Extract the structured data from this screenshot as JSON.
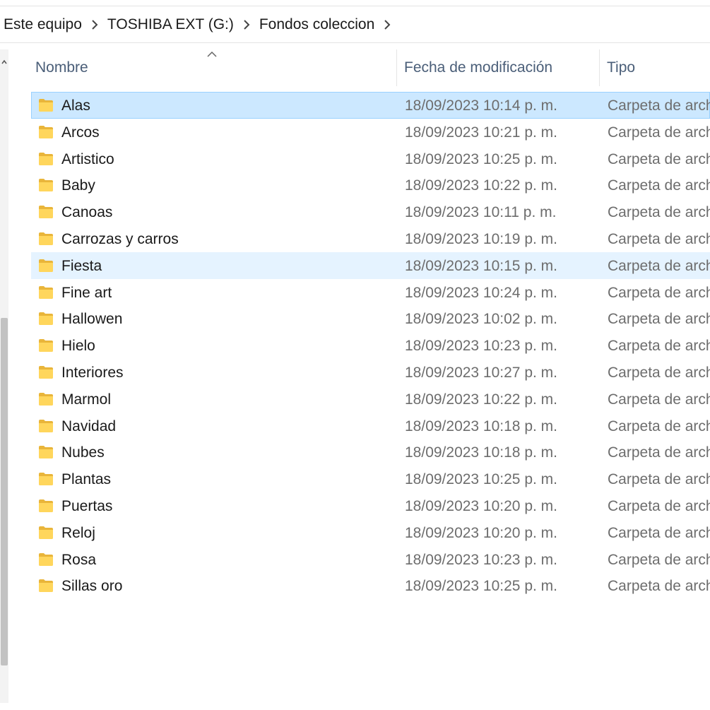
{
  "breadcrumb": {
    "items": [
      {
        "label": "Este equipo"
      },
      {
        "label": "TOSHIBA EXT (G:)"
      },
      {
        "label": "Fondos coleccion"
      }
    ]
  },
  "columns": {
    "name": "Nombre",
    "date": "Fecha de modificación",
    "type": "Tipo",
    "sort_indicator": "ascending-on-name"
  },
  "folders": [
    {
      "name": "Alas",
      "date": "18/09/2023 10:14 p. m.",
      "type": "Carpeta de archivos",
      "state": "selected"
    },
    {
      "name": "Arcos",
      "date": "18/09/2023 10:21 p. m.",
      "type": "Carpeta de archivos",
      "state": ""
    },
    {
      "name": "Artistico",
      "date": "18/09/2023 10:25 p. m.",
      "type": "Carpeta de archivos",
      "state": ""
    },
    {
      "name": "Baby",
      "date": "18/09/2023 10:22 p. m.",
      "type": "Carpeta de archivos",
      "state": ""
    },
    {
      "name": "Canoas",
      "date": "18/09/2023 10:11 p. m.",
      "type": "Carpeta de archivos",
      "state": ""
    },
    {
      "name": "Carrozas y carros",
      "date": "18/09/2023 10:19 p. m.",
      "type": "Carpeta de archivos",
      "state": ""
    },
    {
      "name": "Fiesta",
      "date": "18/09/2023 10:15 p. m.",
      "type": "Carpeta de archivos",
      "state": "hover"
    },
    {
      "name": "Fine art",
      "date": "18/09/2023 10:24 p. m.",
      "type": "Carpeta de archivos",
      "state": ""
    },
    {
      "name": "Hallowen",
      "date": "18/09/2023 10:02 p. m.",
      "type": "Carpeta de archivos",
      "state": ""
    },
    {
      "name": "Hielo",
      "date": "18/09/2023 10:23 p. m.",
      "type": "Carpeta de archivos",
      "state": ""
    },
    {
      "name": "Interiores",
      "date": "18/09/2023 10:27 p. m.",
      "type": "Carpeta de archivos",
      "state": ""
    },
    {
      "name": "Marmol",
      "date": "18/09/2023 10:22 p. m.",
      "type": "Carpeta de archivos",
      "state": ""
    },
    {
      "name": "Navidad",
      "date": "18/09/2023 10:18 p. m.",
      "type": "Carpeta de archivos",
      "state": ""
    },
    {
      "name": "Nubes",
      "date": "18/09/2023 10:18 p. m.",
      "type": "Carpeta de archivos",
      "state": ""
    },
    {
      "name": "Plantas",
      "date": "18/09/2023 10:25 p. m.",
      "type": "Carpeta de archivos",
      "state": ""
    },
    {
      "name": "Puertas",
      "date": "18/09/2023 10:20 p. m.",
      "type": "Carpeta de archivos",
      "state": ""
    },
    {
      "name": "Reloj",
      "date": "18/09/2023 10:20 p. m.",
      "type": "Carpeta de archivos",
      "state": ""
    },
    {
      "name": "Rosa",
      "date": "18/09/2023 10:23 p. m.",
      "type": "Carpeta de archivos",
      "state": ""
    },
    {
      "name": "Sillas oro",
      "date": "18/09/2023 10:25 p. m.",
      "type": "Carpeta de archivos",
      "state": ""
    }
  ],
  "icons": {
    "folder": "folder-icon",
    "chevron": "chevron-right-icon",
    "sort": "sort-ascending-icon"
  },
  "colors": {
    "selected_bg": "#cce8ff",
    "selected_border": "#99d1ff",
    "hover_bg": "#e5f3ff",
    "folder_yellow": "#ffd65c",
    "header_text": "#4a5e78"
  }
}
